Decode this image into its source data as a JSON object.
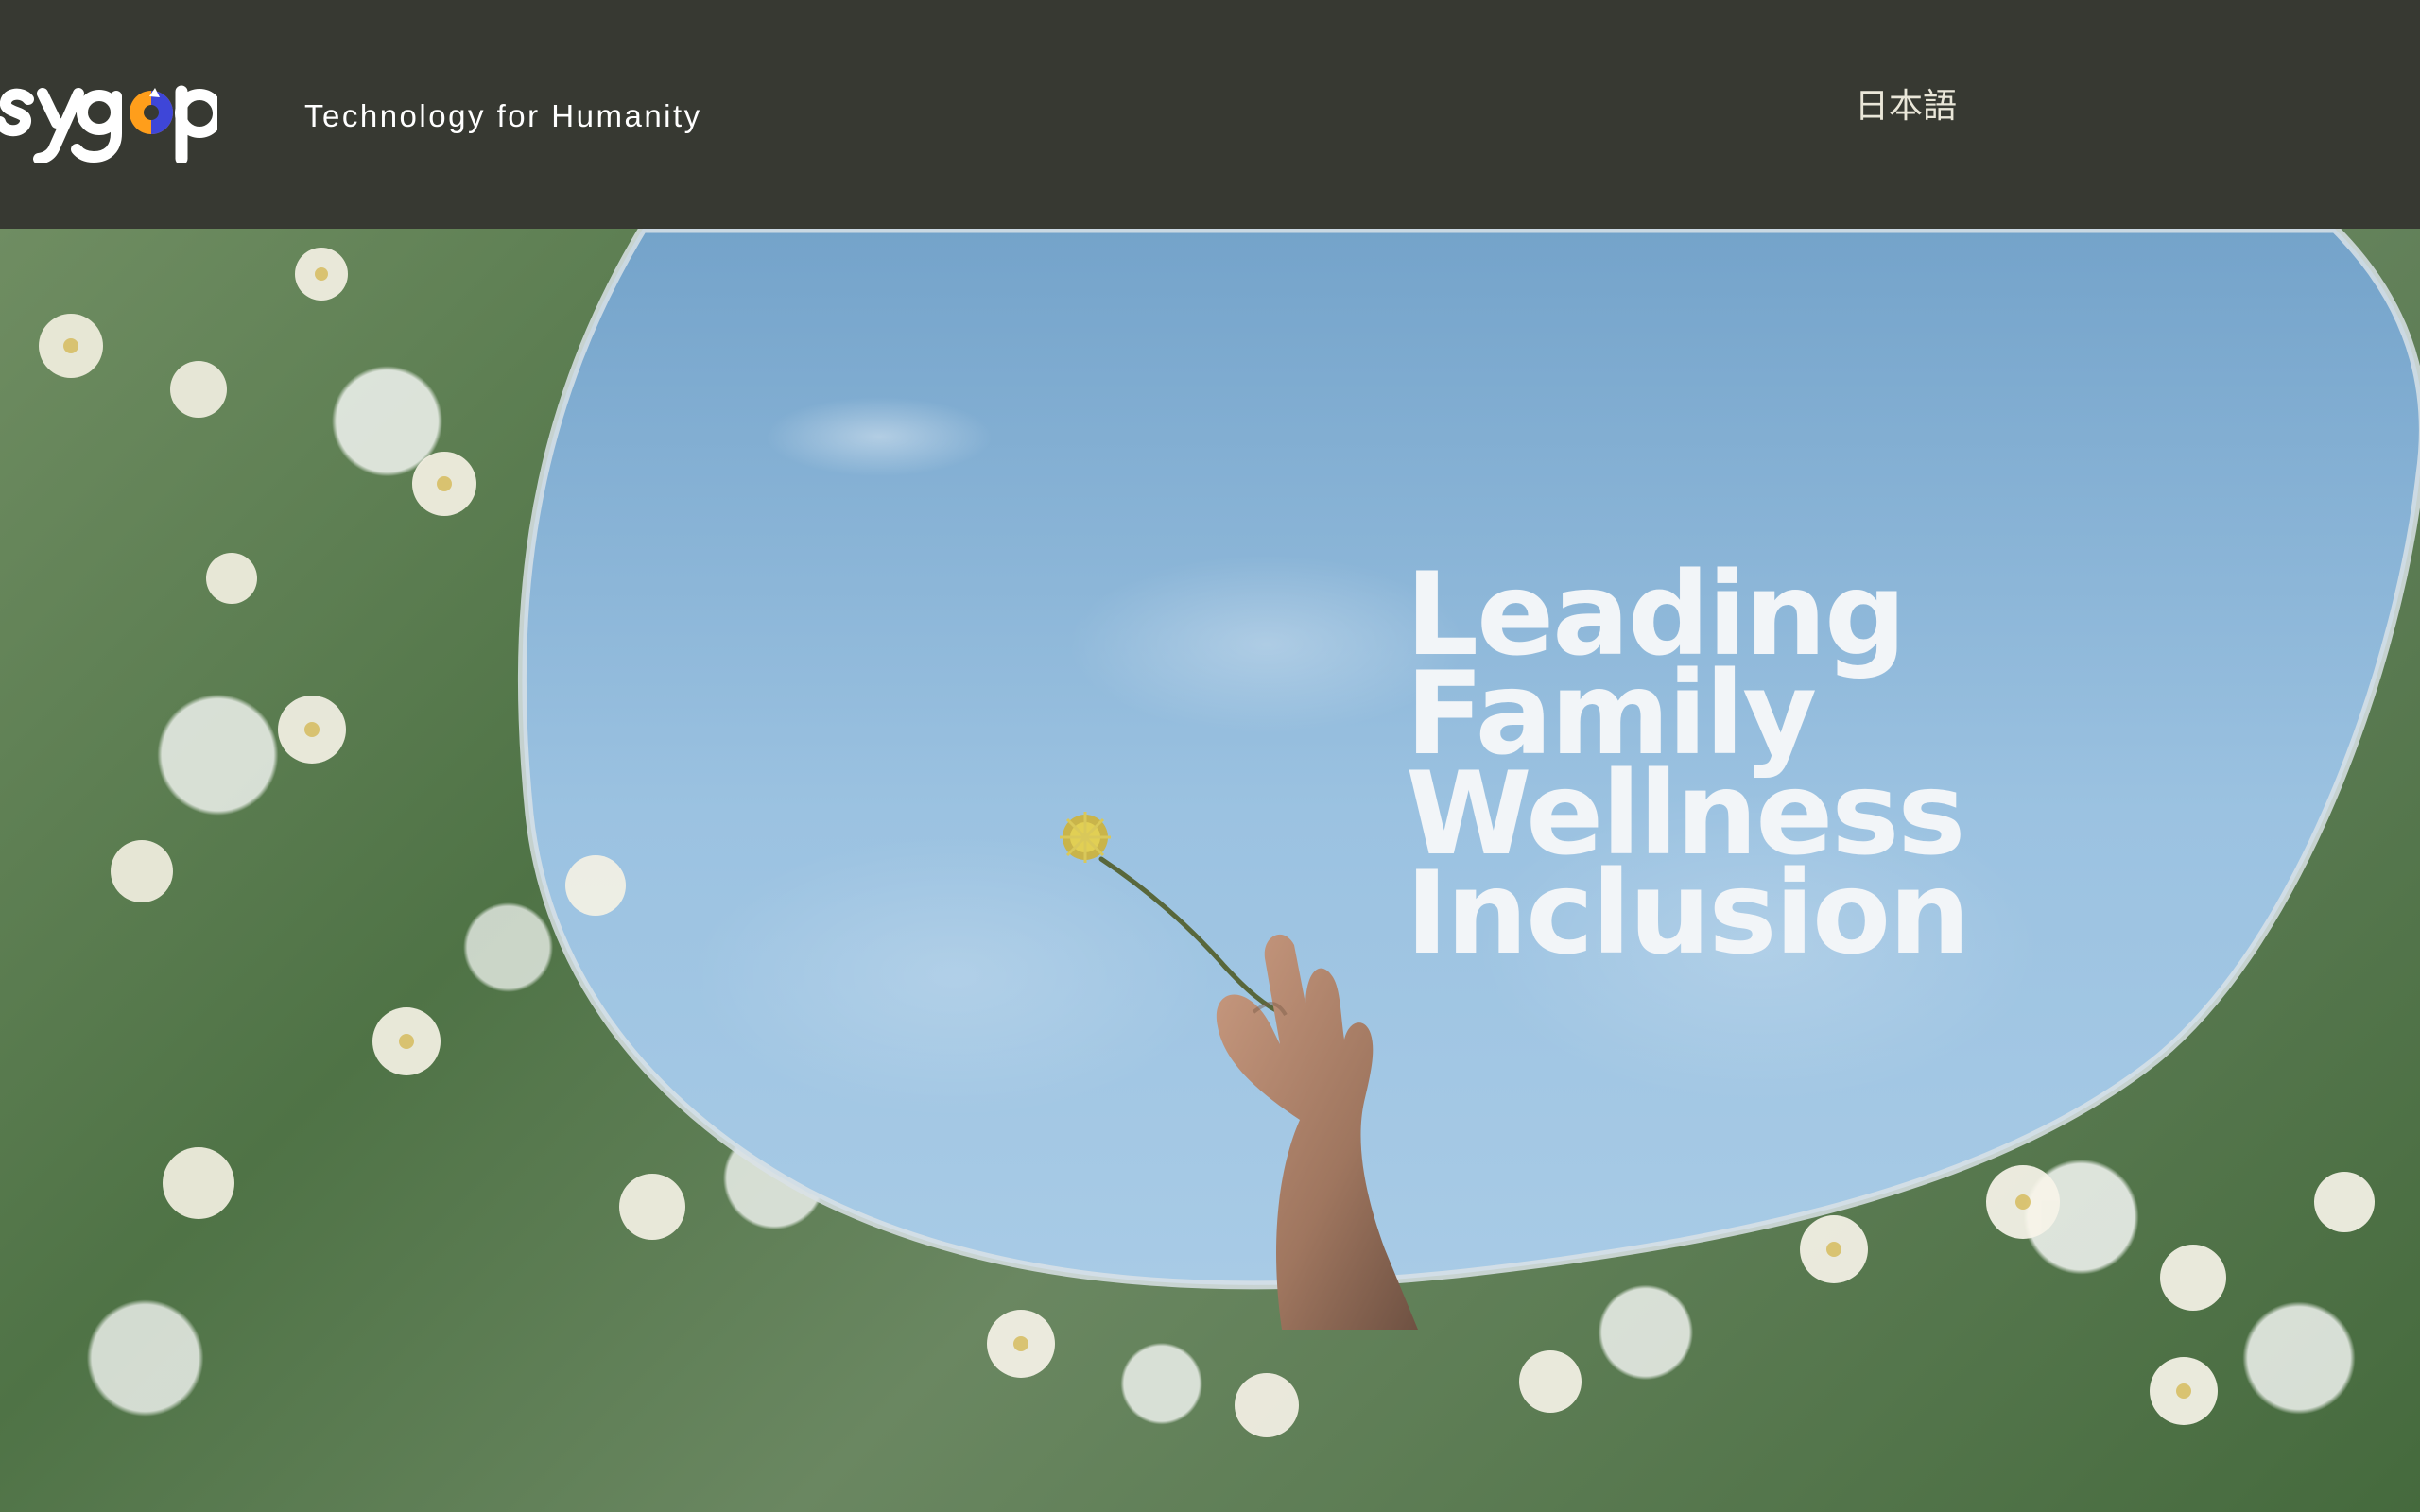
{
  "header": {
    "brand_name": "sygop",
    "tagline": "Technology for Humanity",
    "language_link": "日本語"
  },
  "hero": {
    "headline": [
      "Leading",
      "Family",
      "Wellness",
      "Inclusion"
    ]
  },
  "colors": {
    "header_background": "#373932",
    "header_text": "#ffffff",
    "language_link": "#eae7d9",
    "logo_orange": "#ff9e1b",
    "logo_blue": "#3e46d8",
    "sky_blue": "#8bb6dc",
    "foliage_green": "#4f7346",
    "headline_text": "#f2f5f8"
  },
  "icons": {
    "brand_logo": "sygop-wordmark-logo"
  }
}
